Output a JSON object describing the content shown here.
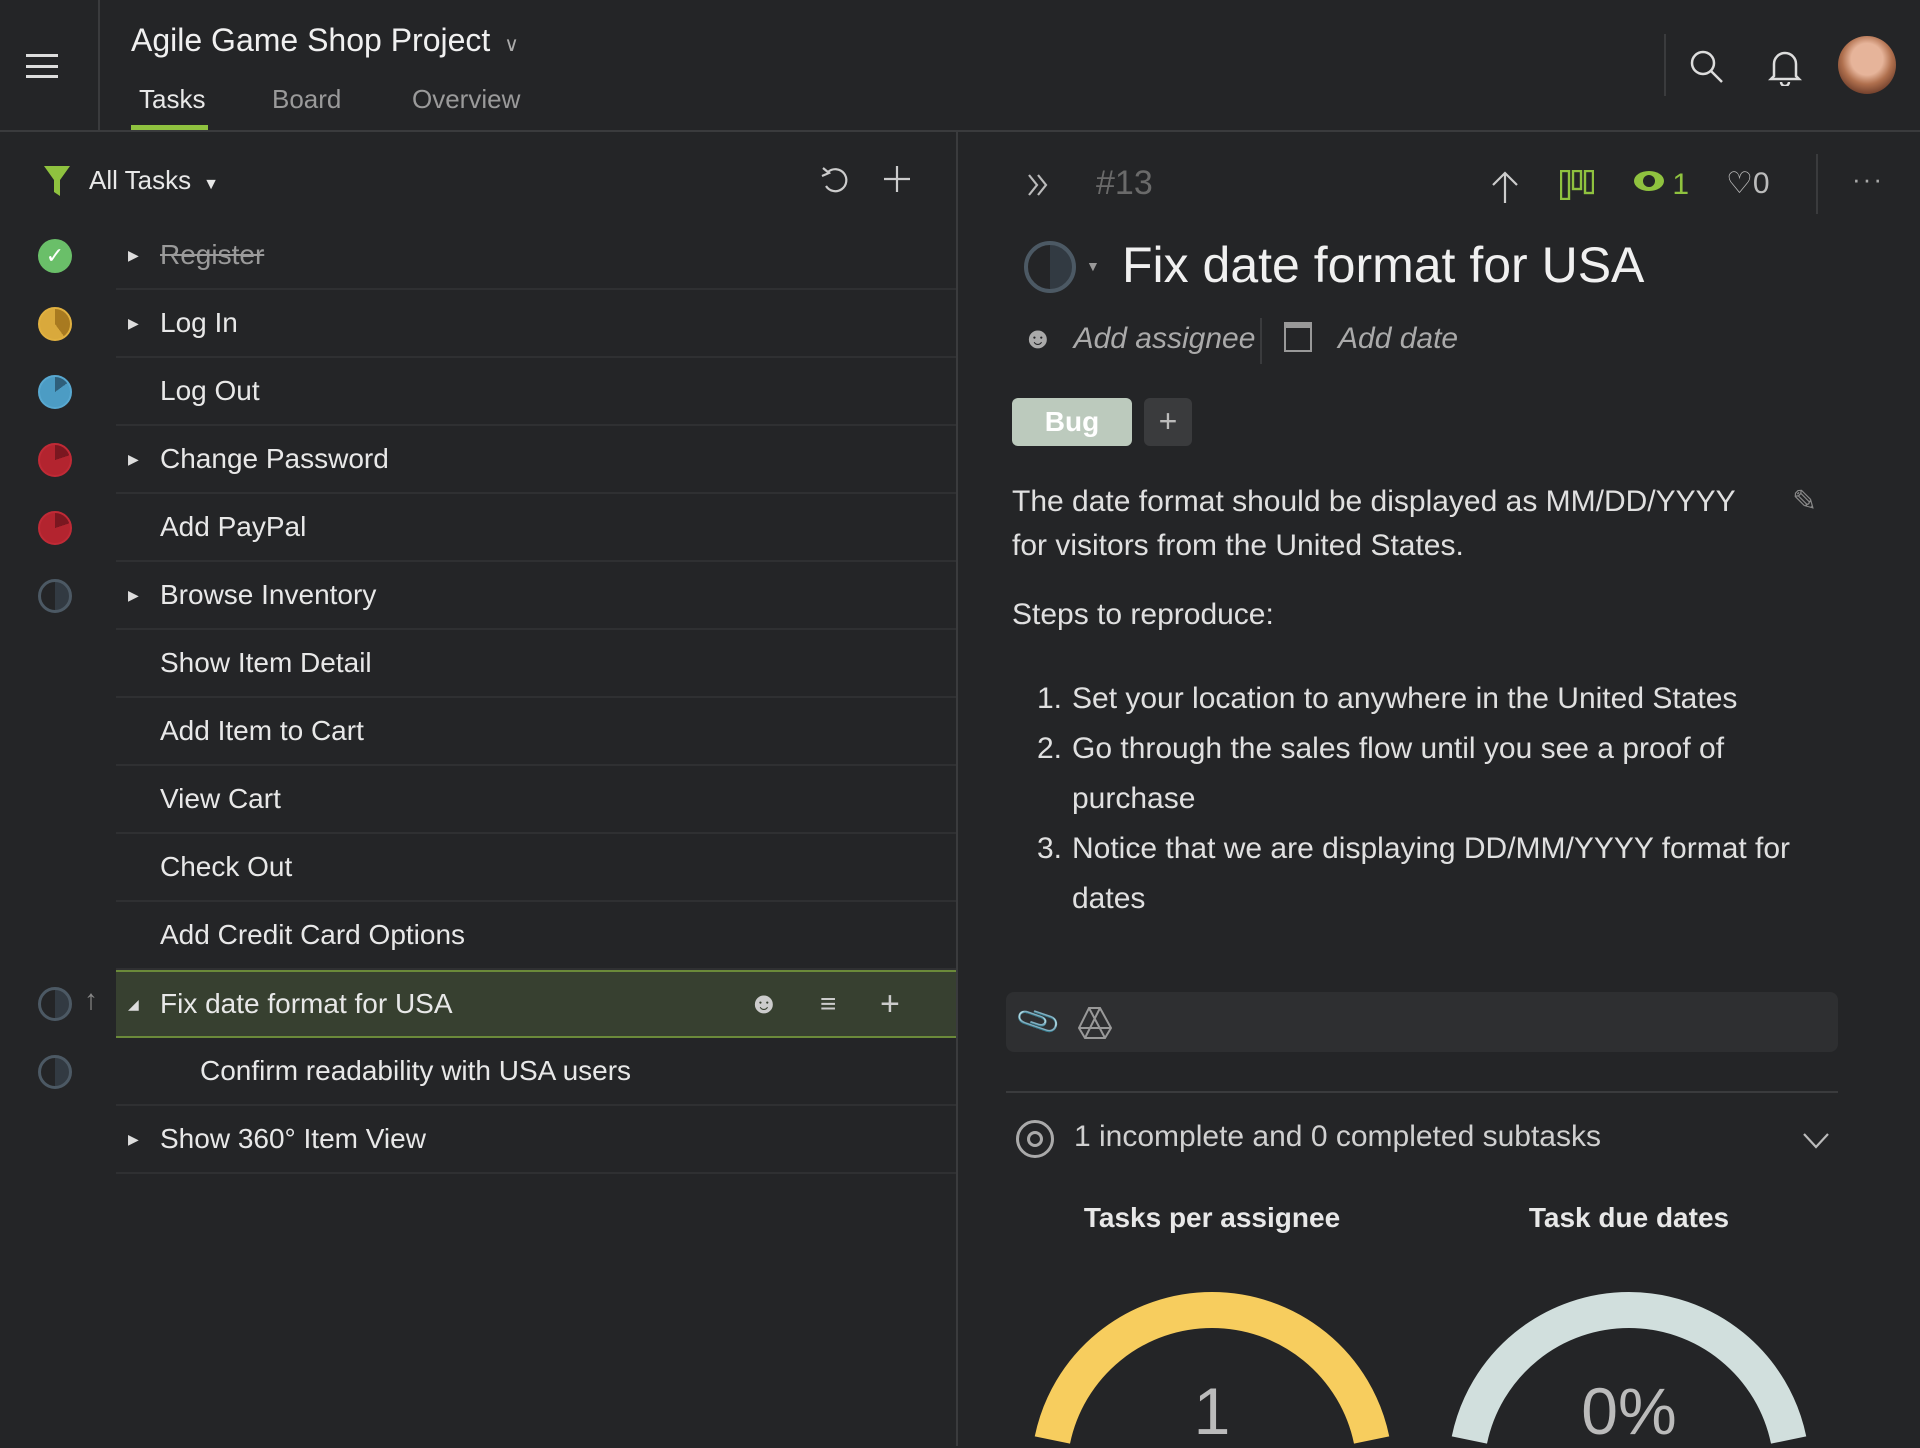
{
  "header": {
    "project_title": "Agile Game Shop Project",
    "tabs": [
      {
        "label": "Tasks",
        "active": true
      },
      {
        "label": "Board"
      },
      {
        "label": "Overview"
      }
    ]
  },
  "task_list": {
    "filter_label": "All Tasks",
    "tasks": [
      {
        "label": "Register",
        "status": "complete",
        "expandable": true
      },
      {
        "label": "Log In",
        "status": "in-progress-yellow",
        "expandable": true
      },
      {
        "label": "Log Out",
        "status": "in-progress-blue",
        "expandable": false
      },
      {
        "label": "Change Password",
        "status": "red",
        "expandable": true
      },
      {
        "label": "Add PayPal",
        "status": "red",
        "expandable": false
      },
      {
        "label": "Browse Inventory",
        "status": "half",
        "expandable": true
      },
      {
        "label": "Show Item Detail",
        "status": "none",
        "expandable": false
      },
      {
        "label": "Add Item to Cart",
        "status": "none",
        "expandable": false
      },
      {
        "label": "View Cart",
        "status": "none",
        "expandable": false
      },
      {
        "label": "Check Out",
        "status": "none",
        "expandable": false
      },
      {
        "label": "Add Credit Card Options",
        "status": "none",
        "expandable": false
      },
      {
        "label": "Fix date format for USA",
        "status": "half",
        "selected": true
      },
      {
        "label": "Confirm readability with USA users",
        "status": "half",
        "subtask": true
      },
      {
        "label": "Show 360° Item View",
        "status": "none",
        "expandable": true
      }
    ]
  },
  "detail": {
    "task_number": "#13",
    "watchers": "1",
    "likes": "0",
    "title": "Fix date format for USA",
    "add_assignee": "Add assignee",
    "add_date": "Add date",
    "tag": "Bug",
    "description_line1": "The date format should be displayed as MM/DD/YYYY",
    "description_line2": "for visitors from the United States.",
    "steps_heading": "Steps to reproduce:",
    "steps": [
      {
        "n": "1.",
        "text": "Set your location to anywhere in the United States"
      },
      {
        "n": "2.",
        "text": "Go through the sales flow until you see a proof of purchase"
      },
      {
        "n": "3.",
        "text": "Notice that we are displaying DD/MM/YYYY format for dates"
      }
    ],
    "subtasks_summary": "1 incomplete and 0 completed subtasks"
  },
  "chart_data": [
    {
      "type": "pie",
      "title": "Tasks per assignee",
      "center_label": "1",
      "values": [
        1
      ],
      "colors": [
        "#f7cd5e"
      ]
    },
    {
      "type": "pie",
      "title": "Task due dates",
      "center_label": "0%",
      "values": [
        1
      ],
      "colors": [
        "#d1dfdd"
      ]
    }
  ],
  "colors": {
    "accent": "#8fc23f",
    "background": "#242527",
    "selected_row": "#374030"
  }
}
